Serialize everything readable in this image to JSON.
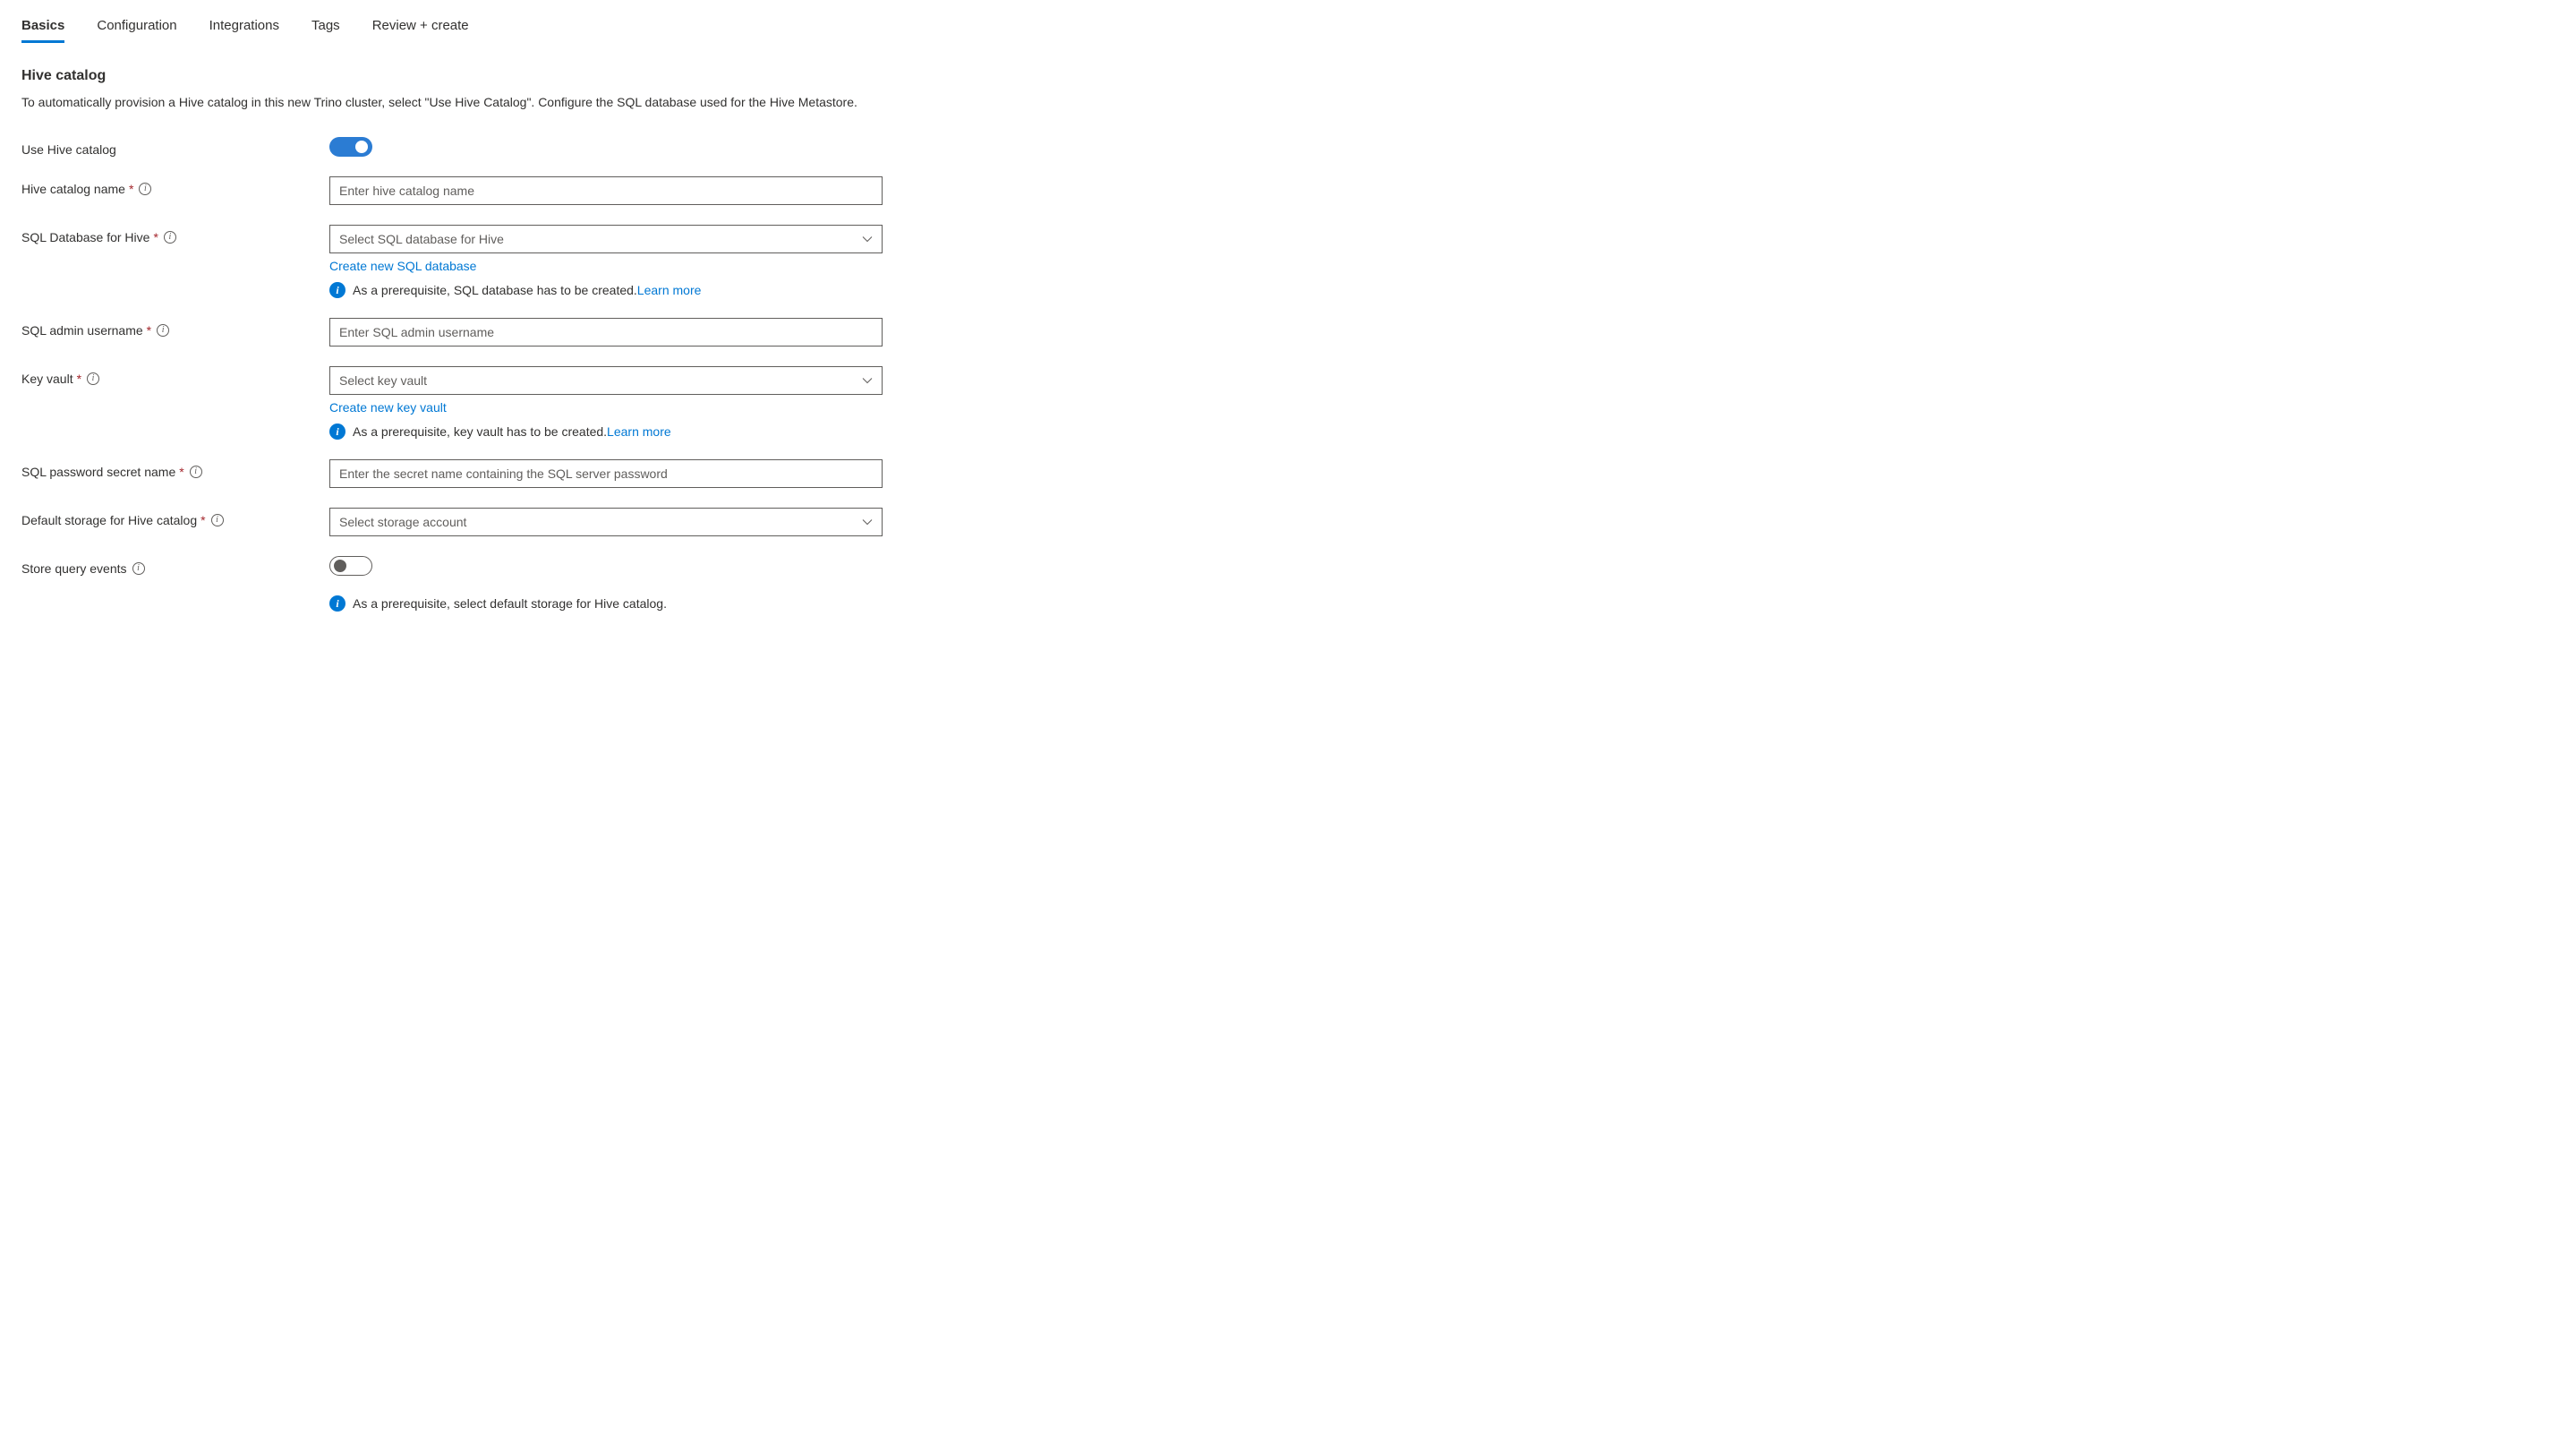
{
  "tabs": {
    "basics": "Basics",
    "configuration": "Configuration",
    "integrations": "Integrations",
    "tags": "Tags",
    "review": "Review + create"
  },
  "section": {
    "title": "Hive catalog",
    "desc": "To automatically provision a Hive catalog in this new Trino cluster, select \"Use Hive Catalog\". Configure the SQL database used for the Hive Metastore."
  },
  "labels": {
    "use_hive": "Use Hive catalog",
    "catalog_name": "Hive catalog name",
    "sql_db": "SQL Database for Hive",
    "sql_user": "SQL admin username",
    "key_vault": "Key vault",
    "sql_secret": "SQL password secret name",
    "default_storage": "Default storage for Hive catalog",
    "store_events": "Store query events"
  },
  "placeholders": {
    "catalog_name": "Enter hive catalog name",
    "sql_db": "Select SQL database for Hive",
    "sql_user": "Enter SQL admin username",
    "key_vault": "Select key vault",
    "sql_secret": "Enter the secret name containing the SQL server password",
    "default_storage": "Select storage account"
  },
  "links": {
    "create_sql": "Create new SQL database",
    "create_kv": "Create new key vault",
    "learn_more": "Learn more"
  },
  "info": {
    "sql_prereq": "As a prerequisite, SQL database has to be created.",
    "kv_prereq": "As a prerequisite, key vault has to be created.",
    "storage_prereq": "As a prerequisite, select default storage for Hive catalog."
  },
  "toggles": {
    "use_hive": true,
    "store_events": false
  }
}
